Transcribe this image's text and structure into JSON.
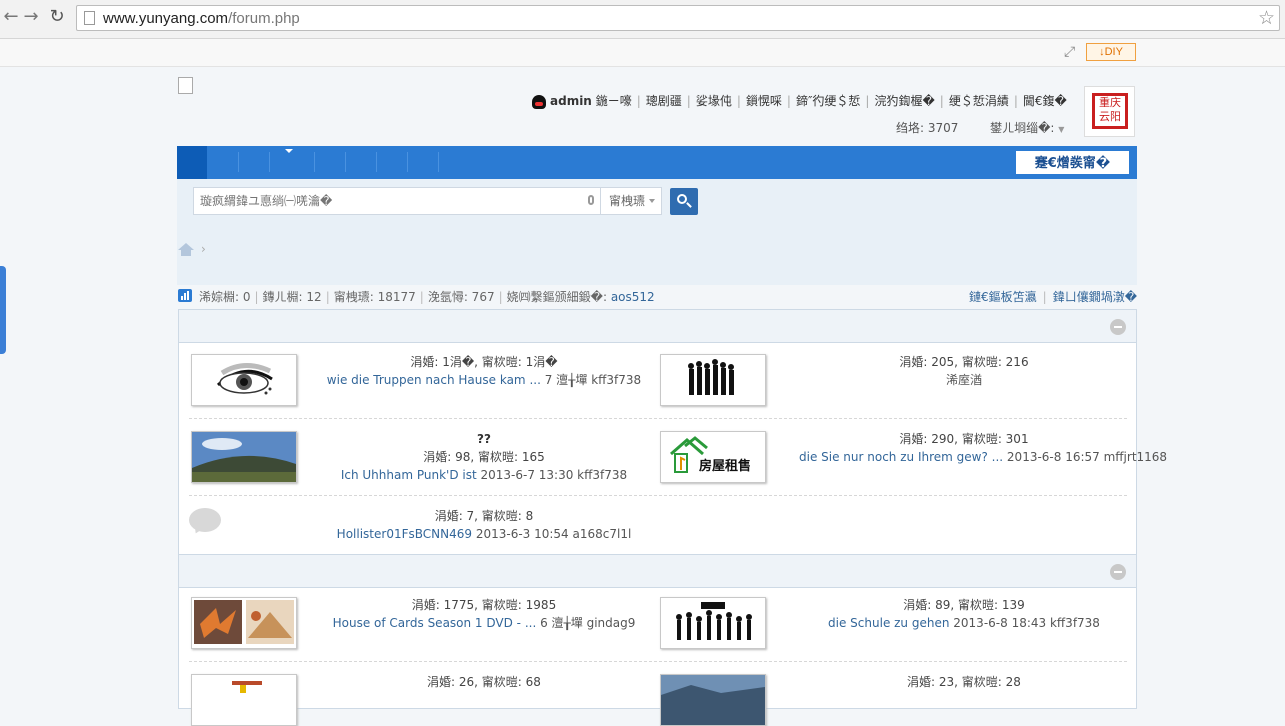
{
  "browser": {
    "url_host": "www.yunyang.com",
    "url_path": "/forum.php",
    "back_icon": "back-arrow-icon",
    "forward_icon": "forward-arrow-icon",
    "reload_icon": "reload-icon",
    "bookmark_icon": "star-icon"
  },
  "diybar": {
    "diy_label": "↓DIY"
  },
  "header": {
    "username": "admin",
    "user_links": [
      "鍦ㄧ嚎",
      "璁剧疆",
      "娑堟伅",
      "鎻愰啋",
      "鍗″彴绠＄悊",
      "浣犳鍧楃�",
      "绠＄悊涓績",
      "閫€鍑�"
    ],
    "credit_label": "绉垎: 3707",
    "group_label": "鐢ㄦ埛缁�:",
    "seal_text": "重庆云阳"
  },
  "nav": {
    "quick_button": "蹇€熷彂甯�"
  },
  "search": {
    "placeholder": "璇疯緭鍏ユ悳绱㈠唴瀹�",
    "scope_label": "甯栧瓙"
  },
  "stats": {
    "today": "浠婃棩: 0",
    "yesterday": "鏄ㄦ棩: 12",
    "posts": "甯栧瓙: 18177",
    "members": "浼氬憳: 767",
    "newest_member_label": "娆㈣繋鏂颁細鍛�:",
    "newest_member": "aos512",
    "link_latest": "鏈€鏂板笘瀛",
    "link_rank": "鍏ㄩ儴鐗堝潡�"
  },
  "forums": [
    {
      "thread_line": "涓婚: 1涓�, 甯栨暟: 1涓�",
      "last_post": "wie die Truppen nach Hause kam ...",
      "last_meta": "7 澶╁墠 kff3f738"
    },
    {
      "thread_line": "涓婚: 205, 甯栨暟: 216",
      "last_post": "",
      "last_meta": "浠庢湭"
    },
    {
      "title": "??",
      "thread_line": "涓婚: 98, 甯栨暟: 165",
      "last_post": "Ich Uhhham Punk'D ist",
      "last_meta": "2013-6-7 13:30 kff3f738"
    },
    {
      "thread_line": "涓婚: 290, 甯栨暟: 301",
      "last_post": "die Sie nur noch zu Ihrem gew? ...",
      "last_meta": "2013-6-8 16:57 mffjrt1168",
      "thumb_text": "房屋租售"
    },
    {
      "thread_line": "涓婚: 7, 甯栨暟: 8",
      "last_post": "Hollister01FsBCNN469",
      "last_meta": "2013-6-3 10:54 a168c7l1l"
    },
    {
      "thread_line": "涓婚: 1775, 甯栨暟: 1985",
      "last_post": "House of Cards Season 1 DVD - ...",
      "last_meta": "6 澶╁墠 gindag9"
    },
    {
      "thread_line": "涓婚: 89, 甯栨暟: 139",
      "last_post": "die Schule zu gehen",
      "last_meta": "2013-6-8 18:43 kff3f738"
    },
    {
      "thread_line": "涓婚: 26, 甯栨暟: 68",
      "last_post": "",
      "last_meta": ""
    },
    {
      "thread_line": "涓婚: 23, 甯栨暟: 28",
      "last_post": "",
      "last_meta": ""
    }
  ]
}
